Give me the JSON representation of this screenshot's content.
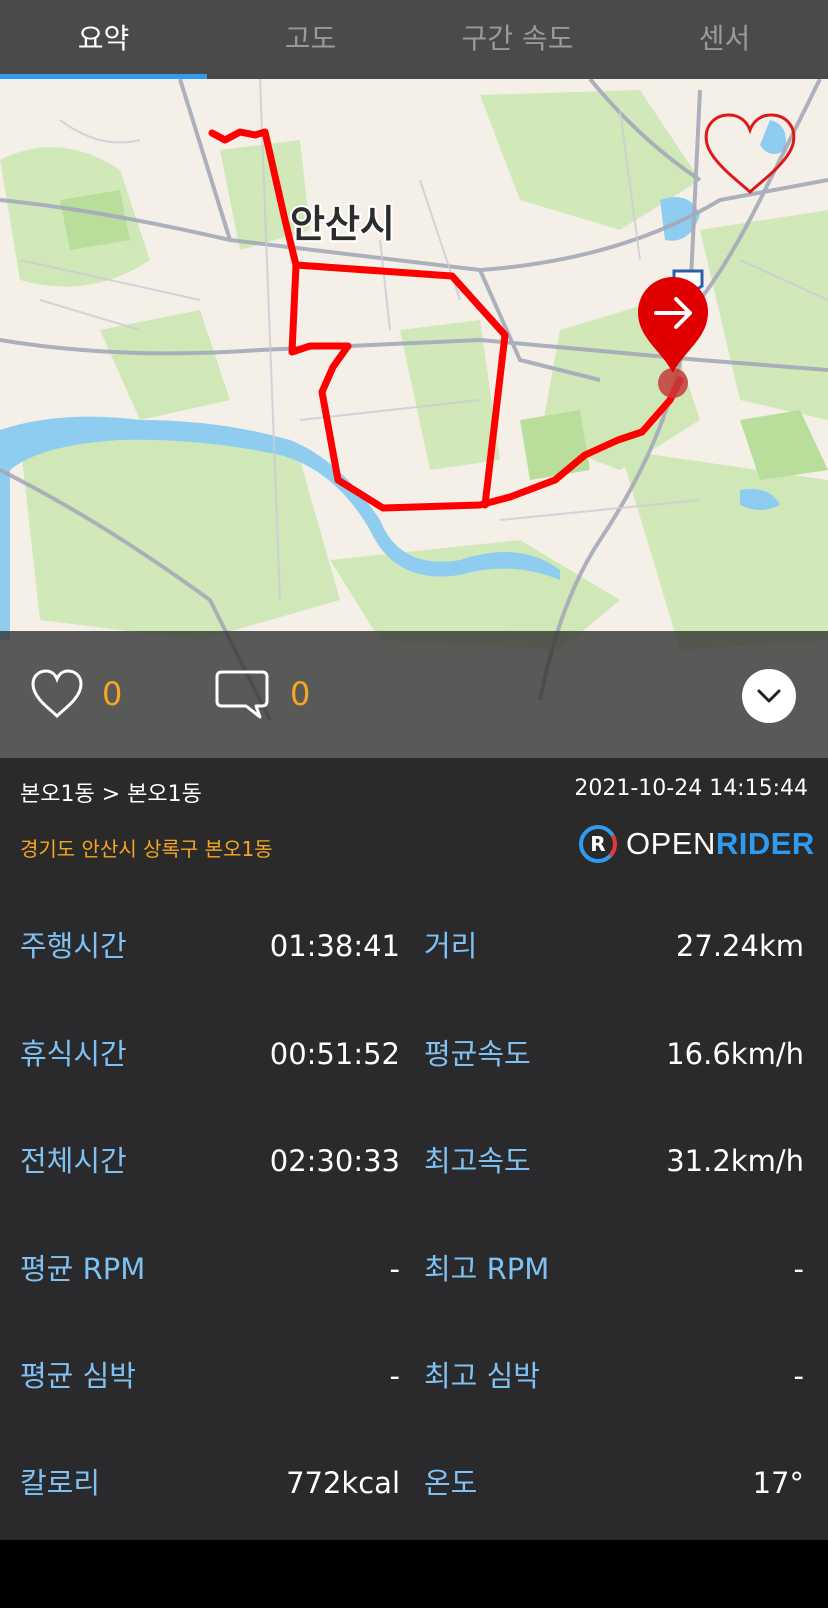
{
  "tabs": [
    {
      "label": "요약",
      "active": true
    },
    {
      "label": "고도",
      "active": false
    },
    {
      "label": "구간 속도",
      "active": false
    },
    {
      "label": "센서",
      "active": false
    }
  ],
  "map": {
    "city_label": "안산시",
    "route_color": "#ff0000"
  },
  "social": {
    "likes": "0",
    "comments": "0"
  },
  "info": {
    "route": "본오1동 > 본오1동",
    "datetime": "2021-10-24 14:15:44",
    "address": "경기도 안산시 상록구 본오1동",
    "brand_part1": "OPEN",
    "brand_part2": "RIDER",
    "brand_icon_letter": "R"
  },
  "stats": [
    {
      "label_left": "주행시간",
      "value_left": "01:38:41",
      "label_right": "거리",
      "value_right": "27.24km"
    },
    {
      "label_left": "휴식시간",
      "value_left": "00:51:52",
      "label_right": "평균속도",
      "value_right": "16.6km/h"
    },
    {
      "label_left": "전체시간",
      "value_left": "02:30:33",
      "label_right": "최고속도",
      "value_right": "31.2km/h"
    },
    {
      "label_left": "평균 RPM",
      "value_left": "-",
      "label_right": "최고 RPM",
      "value_right": "-"
    },
    {
      "label_left": "평균 심박",
      "value_left": "-",
      "label_right": "최고 심박",
      "value_right": "-"
    },
    {
      "label_left": "칼로리",
      "value_left": "772kcal",
      "label_right": "온도",
      "value_right": "17°"
    }
  ],
  "colors": {
    "accent": "#2e9bf0",
    "orange": "#f5a623",
    "label_blue": "#7fc1f2",
    "stats_bg": "#2a2a2c"
  }
}
